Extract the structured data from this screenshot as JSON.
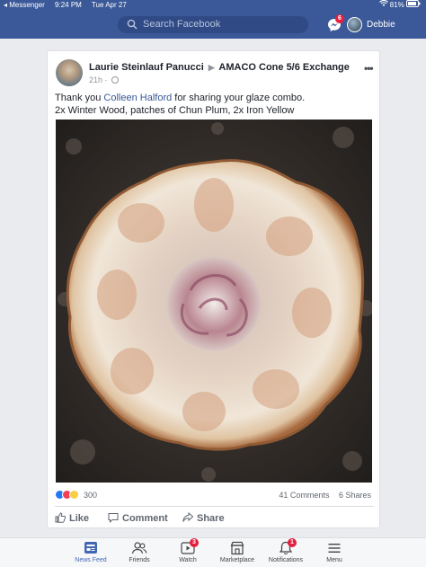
{
  "status_bar": {
    "back_app": "◂ Messenger",
    "time": "9:24 PM",
    "date": "Tue Apr 27",
    "battery": "81%"
  },
  "header": {
    "search_placeholder": "Search Facebook",
    "messenger_badge": "6",
    "user_name": "Debbie",
    "brand_color": "#3b5998"
  },
  "post": {
    "author": "Laurie Steinlauf Panucci",
    "group": "AMACO Cone 5/6 Exchange",
    "time": "21h ·",
    "caption_before": "Thank you ",
    "caption_mention": "Colleen Halford",
    "caption_after": " for sharing your glaze combo.",
    "caption_line2": "2x Winter Wood, patches of Chun Plum, 2x Iron Yellow",
    "reaction_count": "300",
    "comments": "41 Comments",
    "shares": "6 Shares",
    "actions": {
      "like": "Like",
      "comment": "Comment",
      "share": "Share"
    }
  },
  "tabbar": {
    "tabs": [
      {
        "label": "News Feed",
        "icon": "news-feed-icon",
        "active": true
      },
      {
        "label": "Friends",
        "icon": "friends-icon"
      },
      {
        "label": "Watch",
        "icon": "watch-icon",
        "badge": "3"
      },
      {
        "label": "Marketplace",
        "icon": "marketplace-icon"
      },
      {
        "label": "Notifications",
        "icon": "bell-icon",
        "badge": "1"
      },
      {
        "label": "Menu",
        "icon": "menu-icon"
      }
    ]
  }
}
